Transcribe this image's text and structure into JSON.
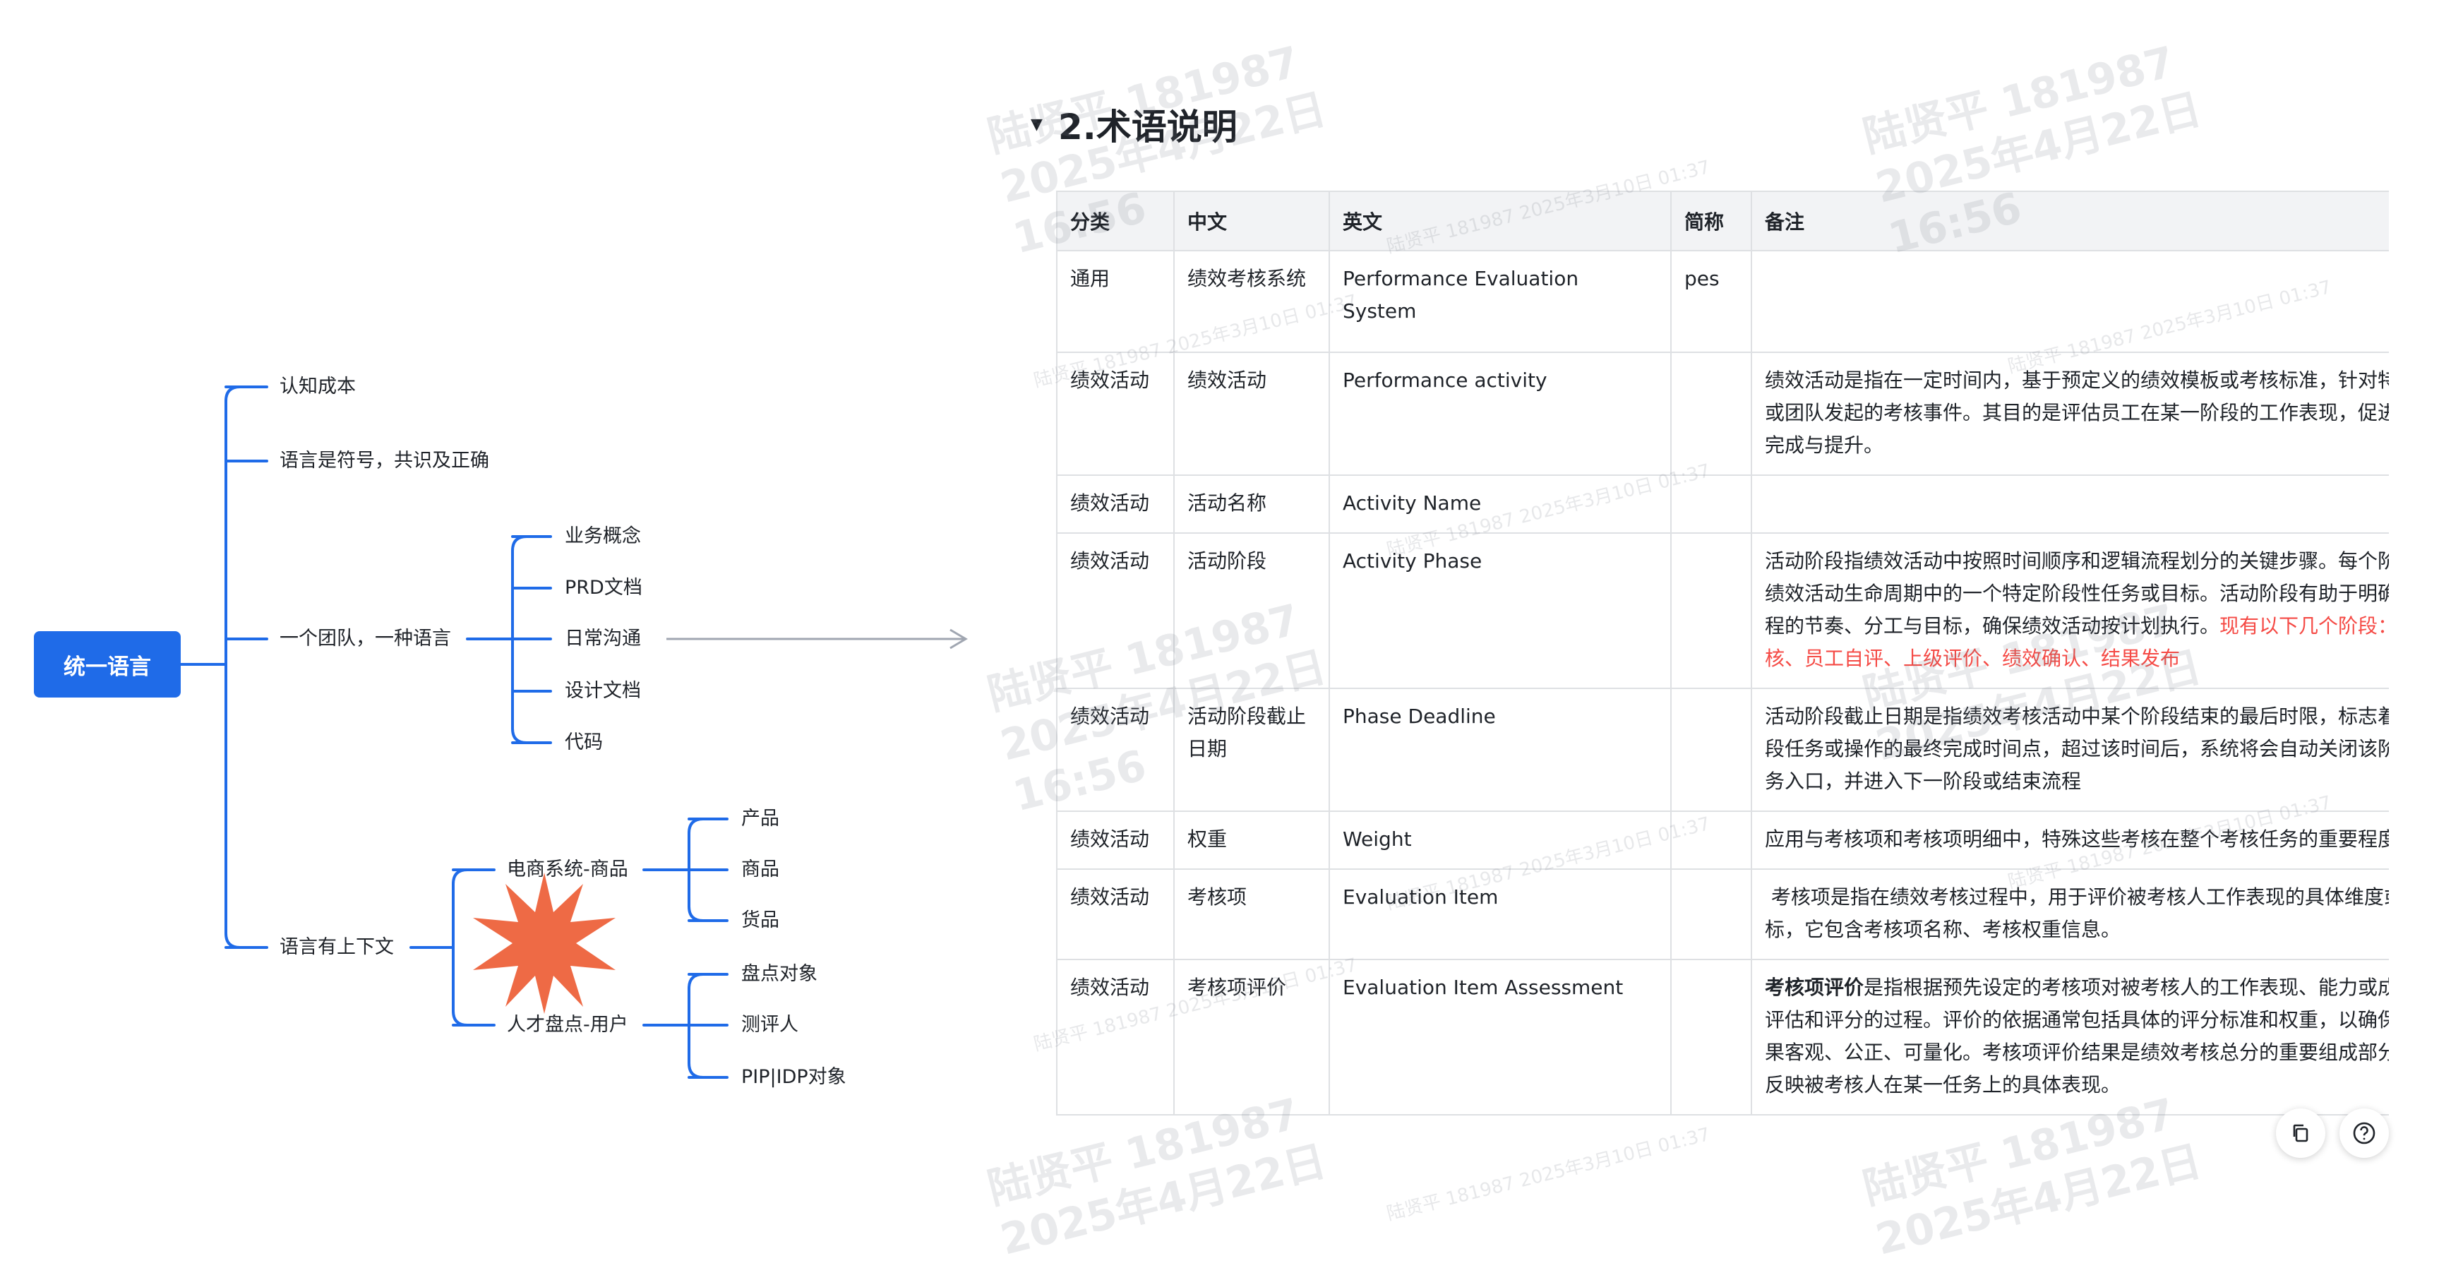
{
  "mindmap": {
    "root": "统一语言",
    "branches": {
      "b1": "认知成本",
      "b2": "语言是符号，共识及正确",
      "b3": "一个团队，一种语言",
      "b3_children": [
        "业务概念",
        "PRD文档",
        "日常沟通",
        "设计文档",
        "代码"
      ],
      "b4": "语言有上下文",
      "b4_ctx1": "电商系统-商品",
      "b4_ctx1_children": [
        "产品",
        "商品",
        "货品"
      ],
      "b4_ctx2": "人才盘点-用户",
      "b4_ctx2_children": [
        "盘点对象",
        "测评人",
        "PIP|IDP对象"
      ]
    },
    "colors": {
      "root": "#1f6be8",
      "line": "#1f6be8",
      "arrow": "#a0a6b1",
      "burst": "#ee6a45"
    }
  },
  "document": {
    "heading": "2.术语说明",
    "columns": [
      "分类",
      "中文",
      "英文",
      "简称",
      "备注"
    ],
    "rows": [
      {
        "category": "通用",
        "zh": "绩效考核系统",
        "en": "Performance Evaluation System",
        "abbr": "pes",
        "note": ""
      },
      {
        "category": "绩效活动",
        "zh": "绩效活动",
        "en": "Performance activity",
        "abbr": "",
        "note": "绩效活动是指在一定时间内，基于预定义的绩效模板或考核标准，针对特定员工或团队发起的考核事件。其目的是评估员工在某一阶段的工作表现，促进目标的完成与提升。"
      },
      {
        "category": "绩效活动",
        "zh": "活动名称",
        "en": "Activity Name",
        "abbr": "",
        "note": ""
      },
      {
        "category": "绩效活动",
        "zh": "活动阶段",
        "en": "Activity Phase",
        "abbr": "",
        "note": "活动阶段指绩效活动中按照时间顺序和逻辑流程划分的关键步骤。每个阶段代表绩效活动生命周期中的一个特定阶段性任务或目标。活动阶段有助于明确考核进程的节奏、分工与目标，确保绩效活动按计划执行。",
        "note_red": "现有以下几个阶段：发起考核、员工自评、上级评价、绩效确认、结果发布"
      },
      {
        "category": "绩效活动",
        "zh": "活动阶段截止日期",
        "en": "Phase Deadline",
        "abbr": "",
        "note": "活动阶段截止日期是指绩效考核活动中某个阶段结束的最后时限，标志着当前阶段任务或操作的最终完成时间点，超过该时间后，系统将会自动关闭该阶段的任务入口，并进入下一阶段或结束流程"
      },
      {
        "category": "绩效活动",
        "zh": "权重",
        "en": "Weight",
        "abbr": "",
        "note": "应用与考核项和考核项明细中，特殊这些考核在整个考核任务的重要程度占比。"
      },
      {
        "category": "绩效活动",
        "zh": "考核项",
        "en": "Evaluation Item",
        "abbr": "",
        "note": " 考核项是指在绩效考核过程中，用于评价被考核人工作表现的具体维度或指标，它包含考核项名称、考核权重信息。"
      },
      {
        "category": "绩效活动",
        "zh": "考核项评价",
        "en": "Evaluation Item Assessment",
        "abbr": "",
        "note_bold": "考核项评价",
        "note": "是指根据预先设定的考核项对被考核人的工作表现、能力或成果进行评估和评分的过程。评价的依据通常包括具体的评分标准和权重，以确保评价结果客观、公正、可量化。考核项评价结果是绩效考核总分的重要组成部分，能够反映被考核人在某一任务上的具体表现。"
      }
    ]
  },
  "watermark": {
    "name_id": "陆贤平 181987",
    "date": "2025年4月22日",
    "time": "16:56",
    "small": "陆贤平 181987 2025年3月10日 01:37"
  },
  "icons": {
    "fab1": "copy-icon",
    "fab2": "help-icon"
  }
}
